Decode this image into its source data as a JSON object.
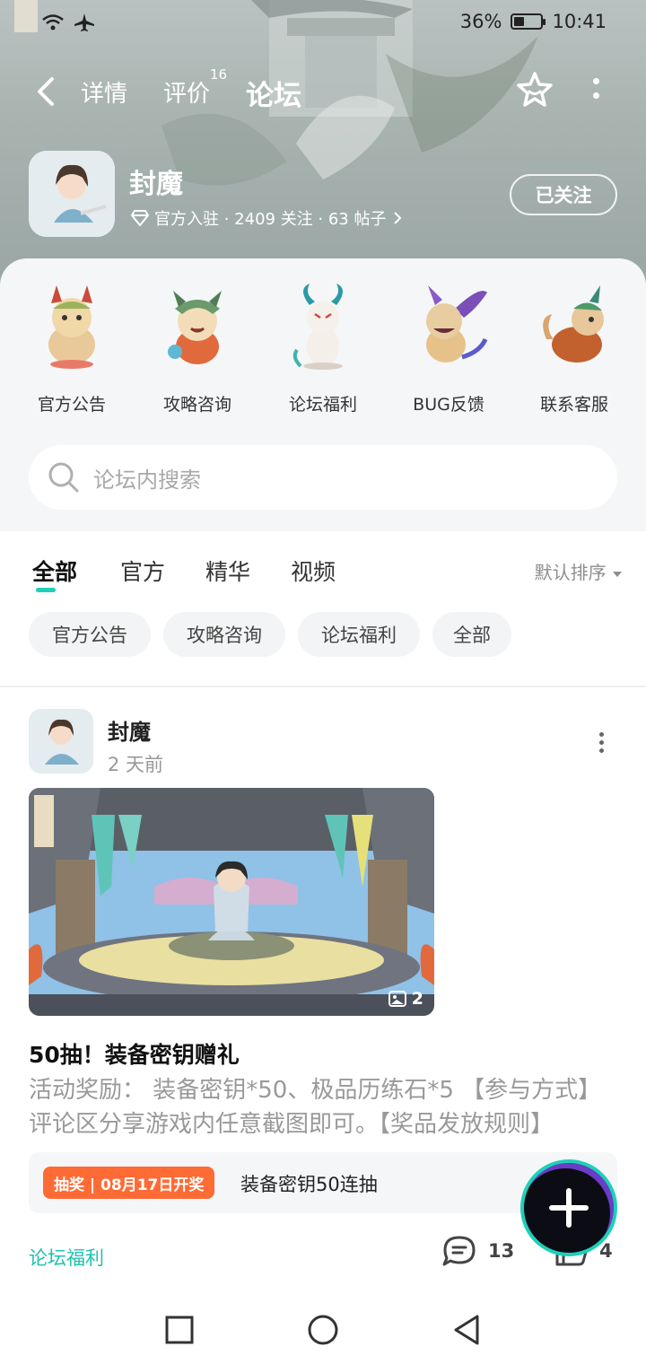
{
  "status_bar": {
    "battery": "36%",
    "battery_level": 0.36,
    "time": "10:41"
  },
  "nav": {
    "tabs": [
      {
        "label": "详情"
      },
      {
        "label": "评价",
        "badge": "16"
      },
      {
        "label": "论坛"
      }
    ],
    "active_tab": "论坛"
  },
  "game": {
    "name": "封魔",
    "meta": "官方入驻 · 2409 关注 · 63 帖子",
    "follow_label": "已关注",
    "icon_name": "game-logo-icon"
  },
  "categories": [
    {
      "label": "官方公告"
    },
    {
      "label": "攻略咨询"
    },
    {
      "label": "论坛福利"
    },
    {
      "label": "BUG反馈"
    },
    {
      "label": "联系客服"
    }
  ],
  "search": {
    "placeholder": "论坛内搜索"
  },
  "filter_tabs": [
    {
      "label": "全部"
    },
    {
      "label": "官方"
    },
    {
      "label": "精华"
    },
    {
      "label": "视频"
    }
  ],
  "sort_label": "默认排序",
  "chips": [
    {
      "label": "官方公告"
    },
    {
      "label": "攻略咨询"
    },
    {
      "label": "论坛福利"
    },
    {
      "label": "全部"
    }
  ],
  "post": {
    "author": "封魔",
    "time": "2 天前",
    "image_count": "2",
    "title": "50抽！装备密钥赠礼",
    "body": "活动奖励： 装备密钥*50、极品历练石*5 【参与方式】 评论区分享游戏内任意截图即可。【奖品发放规则】",
    "lottery_badge": "抽奖 | 08月17日开奖",
    "lottery_text": "装备密钥50连抽",
    "tag": "论坛福利",
    "comments": "13",
    "likes": "4"
  },
  "colors": {
    "accent": "#1ed0b8",
    "badge_orange": "#ff6b35",
    "tag_green": "#1ec2b0"
  }
}
